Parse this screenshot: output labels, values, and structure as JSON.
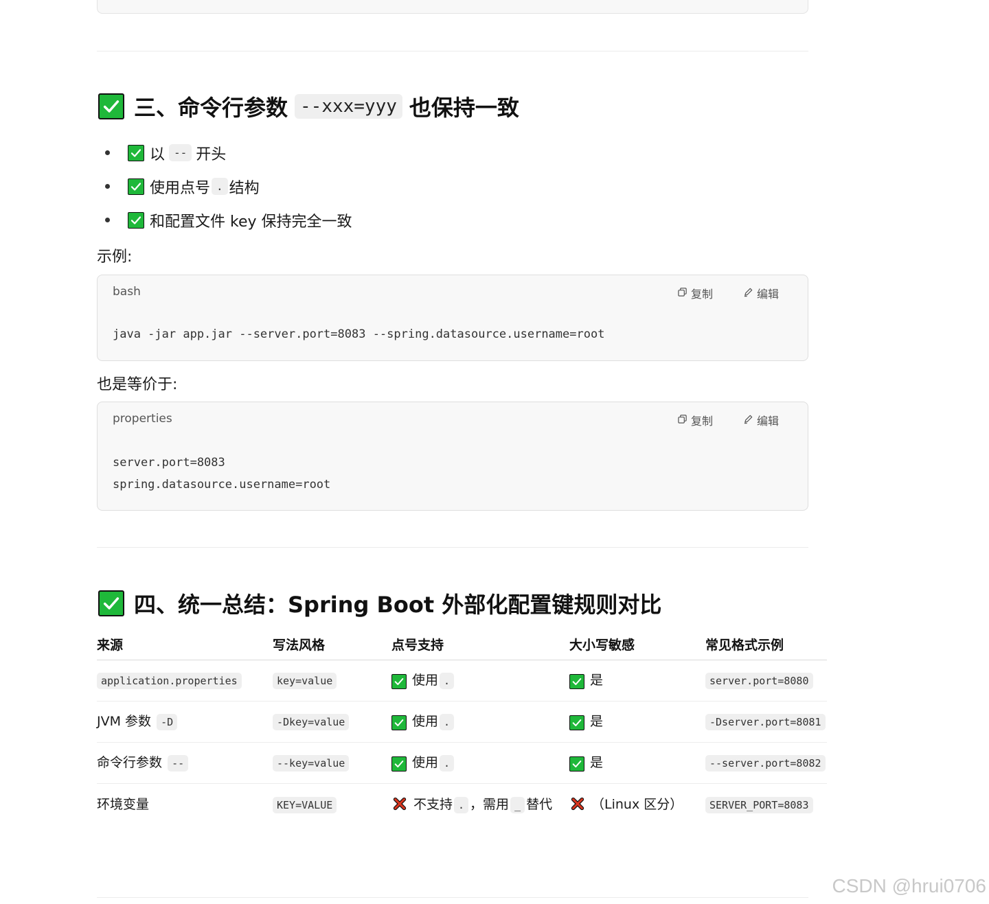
{
  "section3": {
    "heading_pre": "三、命令行参数",
    "heading_code": "--xxx=yyy",
    "heading_post": "也保持一致",
    "bullets": [
      {
        "pre": "以",
        "code": "--",
        "post": "开头"
      },
      {
        "pre": "使用点号",
        "code": ".",
        "post": "结构"
      },
      {
        "pre": "和配置文件 key 保持完全一致",
        "code": "",
        "post": ""
      }
    ],
    "example_label": "示例:",
    "code1": {
      "lang": "bash",
      "copy": "复制",
      "edit": "编辑",
      "lines": [
        "java -jar app.jar --server.port=8083 --spring.datasource.username=root"
      ]
    },
    "equiv_label": "也是等价于:",
    "code2": {
      "lang": "properties",
      "copy": "复制",
      "edit": "编辑",
      "lines": [
        "server.port=8083",
        "spring.datasource.username=root"
      ]
    }
  },
  "section4": {
    "heading": "四、统一总结：Spring Boot 外部化配置键规则对比",
    "table": {
      "headers": [
        "来源",
        "写法风格",
        "点号支持",
        "大小写敏感",
        "常见格式示例"
      ],
      "rows": [
        {
          "source_text": "",
          "source_code": "application.properties",
          "style": "key=value",
          "dot_icon": "check",
          "dot_text": "使用",
          "dot_code": ".",
          "dot_tail": "",
          "case_icon": "check",
          "case_text": "是",
          "example": "server.port=8080"
        },
        {
          "source_text": "JVM 参数",
          "source_code": "-D",
          "style": "-Dkey=value",
          "dot_icon": "check",
          "dot_text": "使用",
          "dot_code": ".",
          "dot_tail": "",
          "case_icon": "check",
          "case_text": "是",
          "example": "-Dserver.port=8081"
        },
        {
          "source_text": "命令行参数",
          "source_code": "--",
          "style": "--key=value",
          "dot_icon": "check",
          "dot_text": "使用",
          "dot_code": ".",
          "dot_tail": "",
          "case_icon": "check",
          "case_text": "是",
          "example": "--server.port=8082"
        },
        {
          "source_text": "环境变量",
          "source_code": "",
          "style": "KEY=VALUE",
          "dot_icon": "cross",
          "dot_text": "不支持",
          "dot_code": ".",
          "dot_tail": "，需用",
          "dot_code2": "_",
          "dot_tail2": "替代",
          "case_icon": "cross",
          "case_text": "（Linux 区分）",
          "example": "SERVER_PORT=8083"
        }
      ]
    }
  },
  "watermark": "CSDN @hrui0706"
}
